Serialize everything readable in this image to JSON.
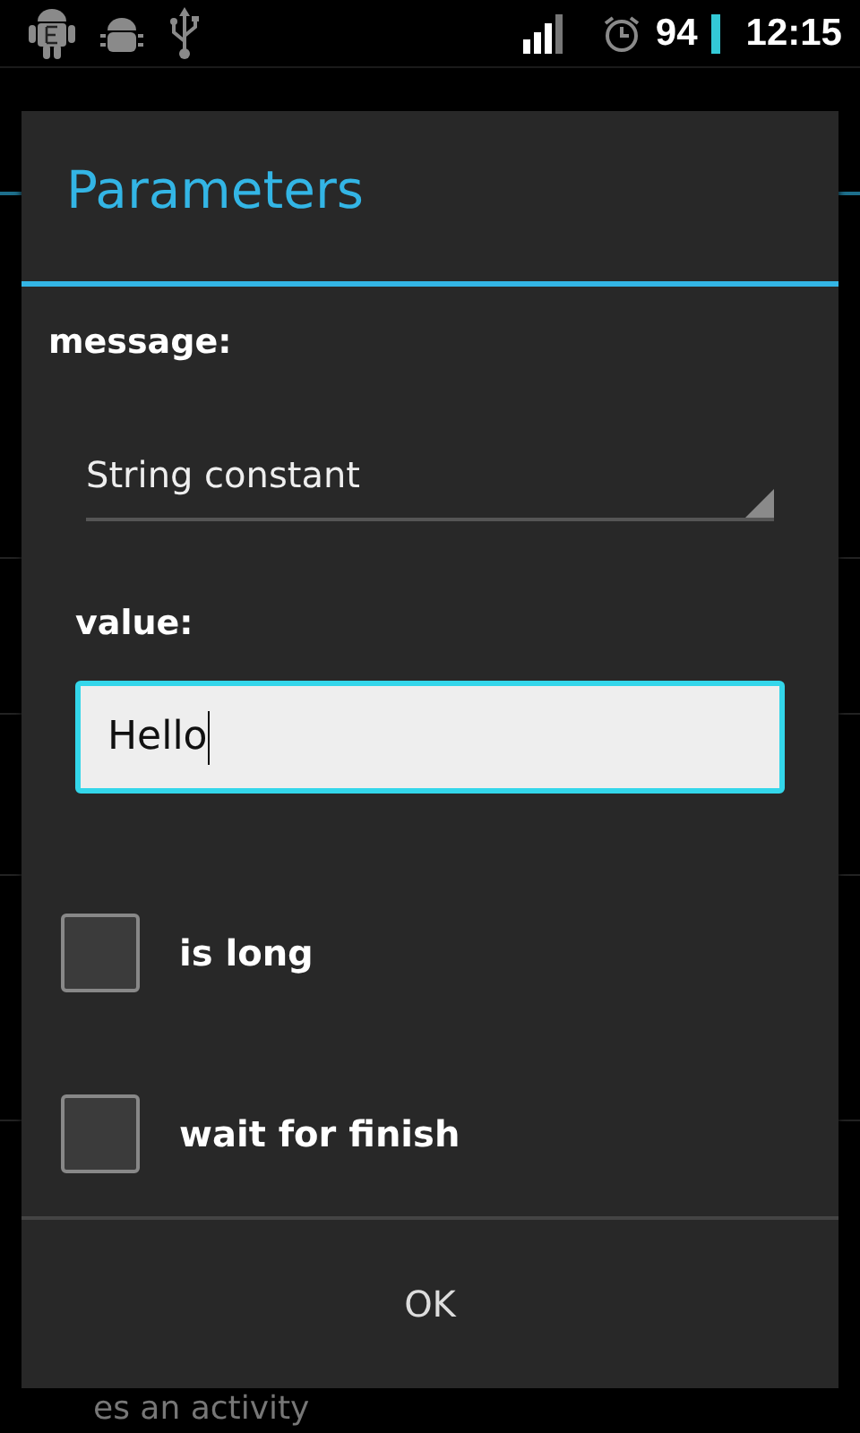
{
  "status_bar": {
    "battery": "94",
    "time": "12:15"
  },
  "dialog": {
    "title": "Parameters",
    "fields": [
      {
        "kind": "spinner",
        "label": "message:",
        "value": "String constant"
      },
      {
        "kind": "text",
        "label": "value:",
        "value": "Hello",
        "focused": true
      }
    ],
    "checkboxes": [
      {
        "label": "is long",
        "checked": false
      },
      {
        "label": "wait for finish",
        "checked": false
      }
    ],
    "buttons": [
      "OK"
    ]
  },
  "background": {
    "item_text": "es an activity"
  }
}
